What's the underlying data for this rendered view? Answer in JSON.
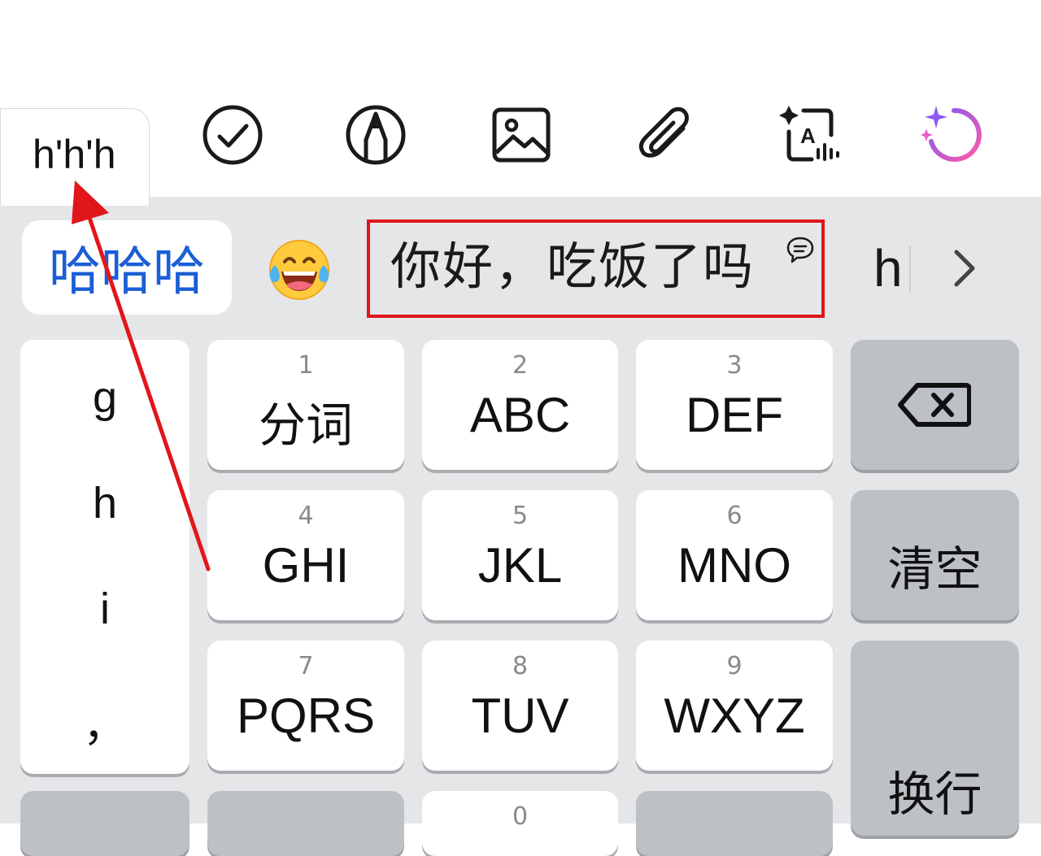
{
  "composing": {
    "text": "h'h'h"
  },
  "toolbar": {
    "icons": [
      "check-circle-icon",
      "pen-icon",
      "image-icon",
      "paperclip-icon",
      "ai-translate-icon",
      "ai-assistant-icon"
    ]
  },
  "candidates": {
    "first": "哈哈哈",
    "emoji": "face-with-tears-of-joy",
    "phrase": "你好，吃饭了吗",
    "next": "h",
    "expand_icon": "chevron-right-icon"
  },
  "side_column": [
    "g",
    "h",
    "i",
    "，"
  ],
  "keys": [
    {
      "num": "1",
      "label": "分词"
    },
    {
      "num": "2",
      "label": "ABC"
    },
    {
      "num": "3",
      "label": "DEF"
    },
    {
      "num": "4",
      "label": "GHI"
    },
    {
      "num": "5",
      "label": "JKL"
    },
    {
      "num": "6",
      "label": "MNO"
    },
    {
      "num": "7",
      "label": "PQRS"
    },
    {
      "num": "8",
      "label": "TUV"
    },
    {
      "num": "9",
      "label": "WXYZ"
    },
    {
      "num": "0",
      "label": ""
    }
  ],
  "function_keys": {
    "backspace_icon": "backspace-icon",
    "clear": "清空",
    "enter": "换行"
  },
  "colors": {
    "accent_blue": "#1b5ed6",
    "highlight_red": "#e0161b",
    "keyboard_bg": "#e5e6e8",
    "function_key": "#bdc1c6"
  }
}
